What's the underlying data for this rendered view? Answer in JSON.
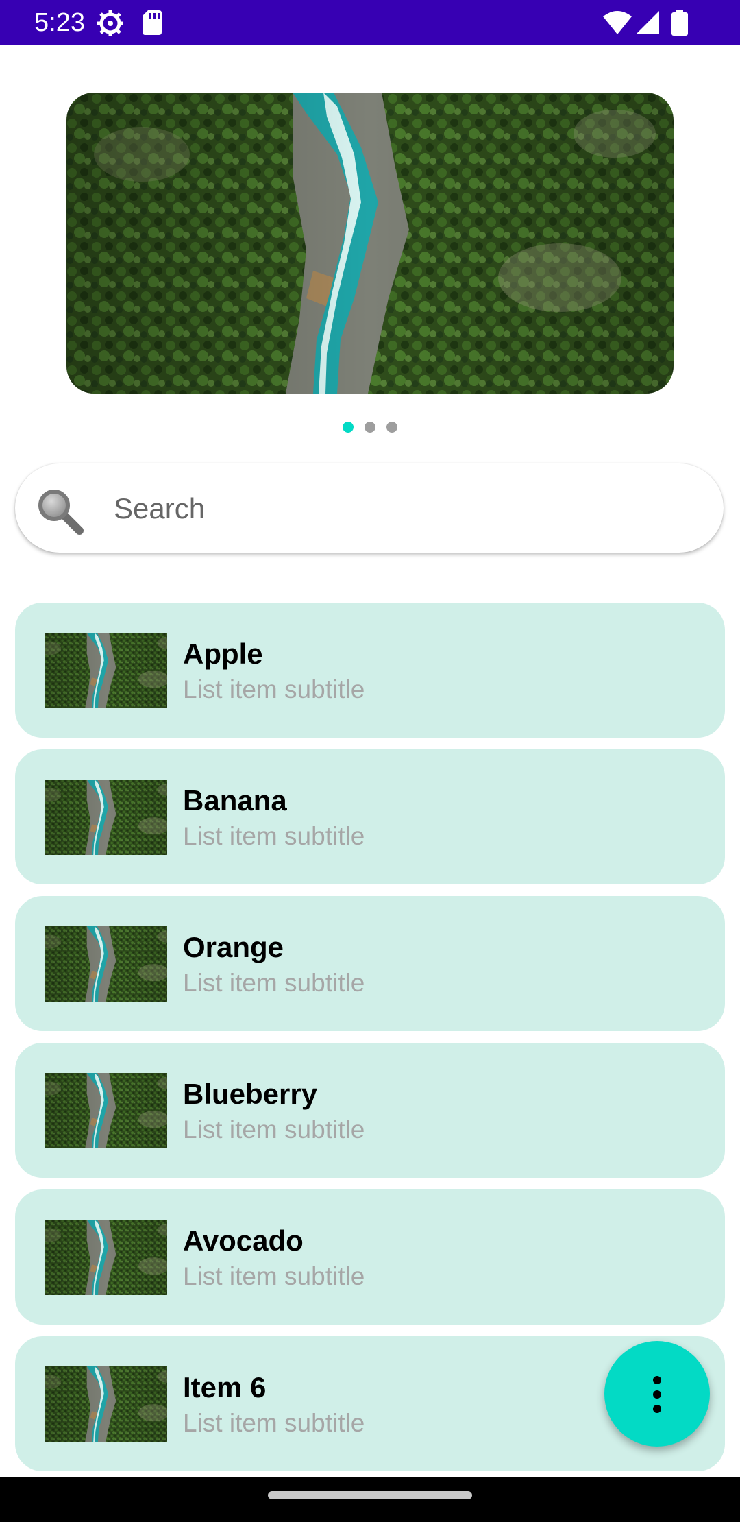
{
  "status_bar": {
    "time": "5:23",
    "icons": [
      "gear-icon",
      "sd-card-icon",
      "wifi-icon",
      "signal-icon",
      "battery-icon"
    ],
    "background_color": "#3700b3"
  },
  "carousel": {
    "image": "aerial-river-forest-image",
    "page_count": 3,
    "active_page": 1,
    "active_dot_color": "#03dac5",
    "inactive_dot_color": "#9e9e9e"
  },
  "search": {
    "placeholder": "Search",
    "icon": "search-icon"
  },
  "list": {
    "item_background": "#d0efe8",
    "items": [
      {
        "title": "Apple",
        "subtitle": "List item subtitle",
        "thumbnail": "aerial-river-forest-image"
      },
      {
        "title": "Banana",
        "subtitle": "List item subtitle",
        "thumbnail": "aerial-river-forest-image"
      },
      {
        "title": "Orange",
        "subtitle": "List item subtitle",
        "thumbnail": "aerial-river-forest-image"
      },
      {
        "title": "Blueberry",
        "subtitle": "List item subtitle",
        "thumbnail": "aerial-river-forest-image"
      },
      {
        "title": "Avocado",
        "subtitle": "List item subtitle",
        "thumbnail": "aerial-river-forest-image"
      },
      {
        "title": "Item 6",
        "subtitle": "List item subtitle",
        "thumbnail": "aerial-river-forest-image"
      }
    ]
  },
  "fab": {
    "icon": "more-vertical-icon",
    "color": "#03dac5"
  }
}
